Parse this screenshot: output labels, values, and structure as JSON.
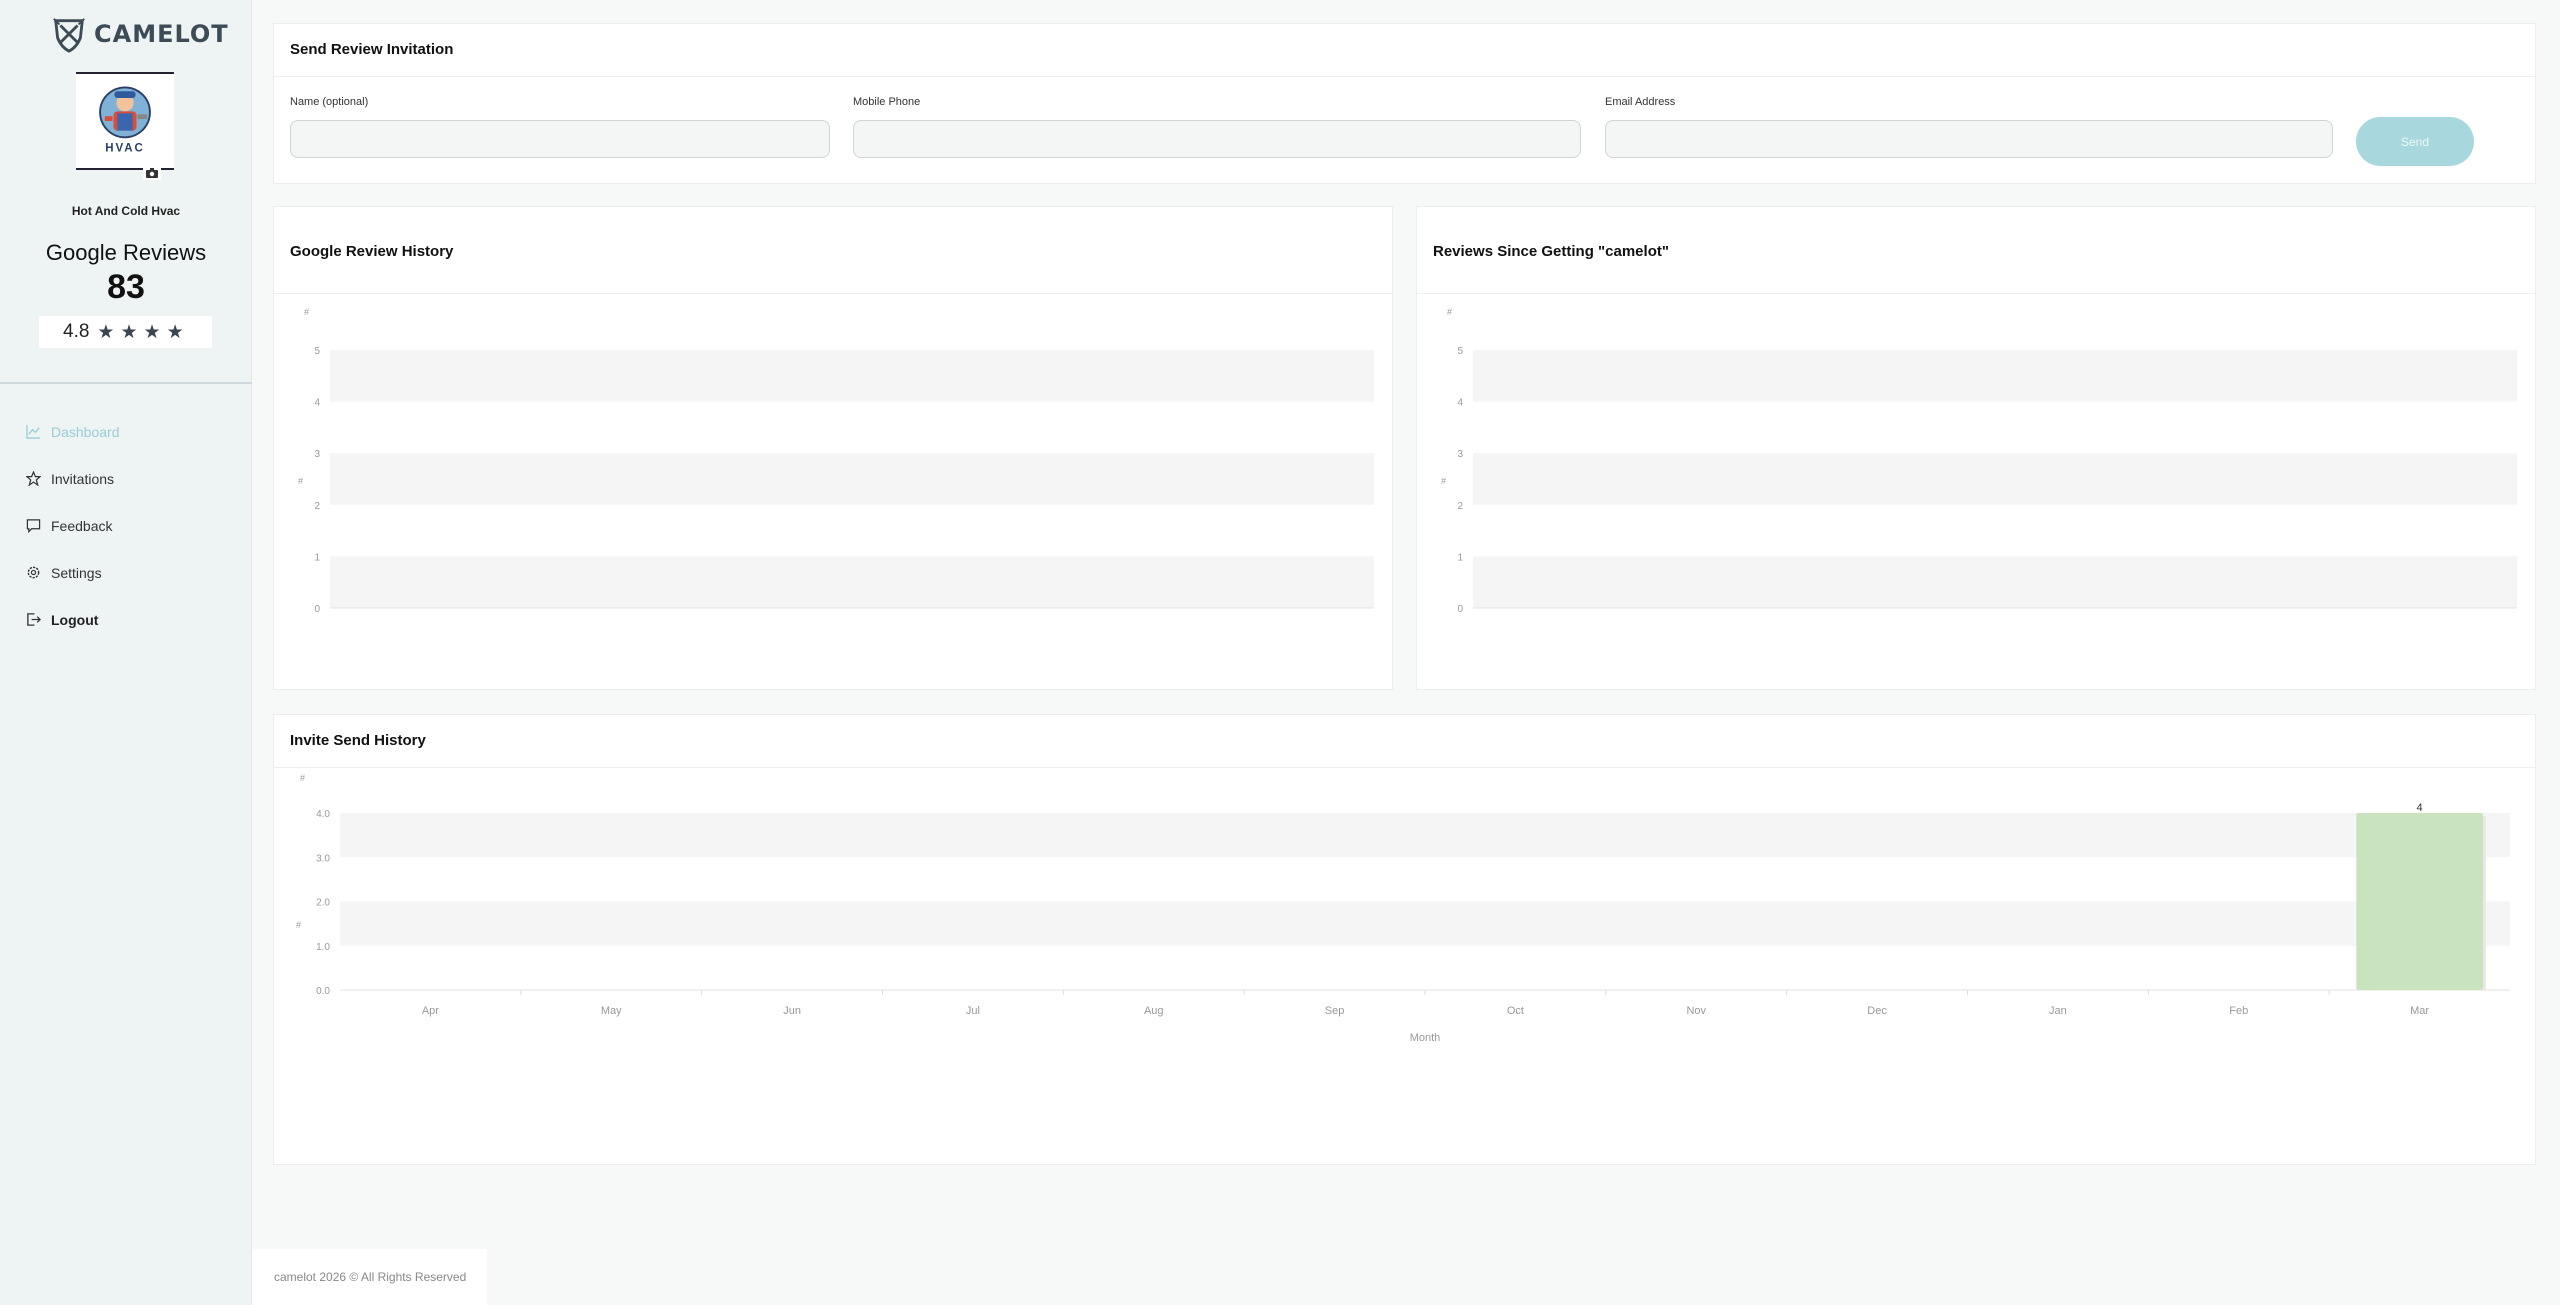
{
  "brand": {
    "name": "CAMELOT"
  },
  "profile": {
    "logo_text": "HVAC",
    "business_name": "Hot And Cold Hvac",
    "reviews_title": "Google Reviews",
    "reviews_count": "83",
    "rating": "4.8",
    "stars": 4
  },
  "nav": {
    "items": [
      {
        "label": "Dashboard",
        "icon": "chart-line-icon"
      },
      {
        "label": "Invitations",
        "icon": "star-icon"
      },
      {
        "label": "Feedback",
        "icon": "message-icon"
      },
      {
        "label": "Settings",
        "icon": "gear-icon"
      },
      {
        "label": "Logout",
        "icon": "logout-icon"
      }
    ]
  },
  "invite": {
    "title": "Send Review Invitation",
    "name_label": "Name (optional)",
    "name_value": "",
    "phone_label": "Mobile Phone",
    "phone_value": "",
    "email_label": "Email Address",
    "email_value": "",
    "send_label": "Send"
  },
  "google_history": {
    "title": "Google Review History",
    "y_ticks": [
      "0",
      "1",
      "2",
      "3",
      "4",
      "5"
    ],
    "y_label": "#",
    "y_top_label": "#"
  },
  "since_camelot": {
    "title": "Reviews Since Getting \"camelot\"",
    "y_ticks": [
      "0",
      "1",
      "2",
      "3",
      "4",
      "5"
    ],
    "y_label": "#",
    "y_top_label": "#"
  },
  "invite_history": {
    "title": "Invite Send History"
  },
  "chart_data": {
    "type": "bar",
    "categories": [
      "Apr",
      "May",
      "Jun",
      "Jul",
      "Aug",
      "Sep",
      "Oct",
      "Nov",
      "Dec",
      "Jan",
      "Feb",
      "Mar"
    ],
    "values": [
      0,
      0,
      0,
      0,
      0,
      0,
      0,
      0,
      0,
      0,
      0,
      4
    ],
    "y_ticks": [
      "0.0",
      "1.0",
      "2.0",
      "3.0",
      "4.0"
    ],
    "ylim": [
      0,
      4
    ],
    "xlabel": "Month",
    "ylabel": "#",
    "y_top_label": "#",
    "bar_color": "#c9e3bf",
    "data_labels": [
      "",
      "",
      "",
      "",
      "",
      "",
      "",
      "",
      "",
      "",
      "",
      "4"
    ]
  },
  "footer": {
    "text": "camelot 2026 © All Rights Reserved"
  }
}
